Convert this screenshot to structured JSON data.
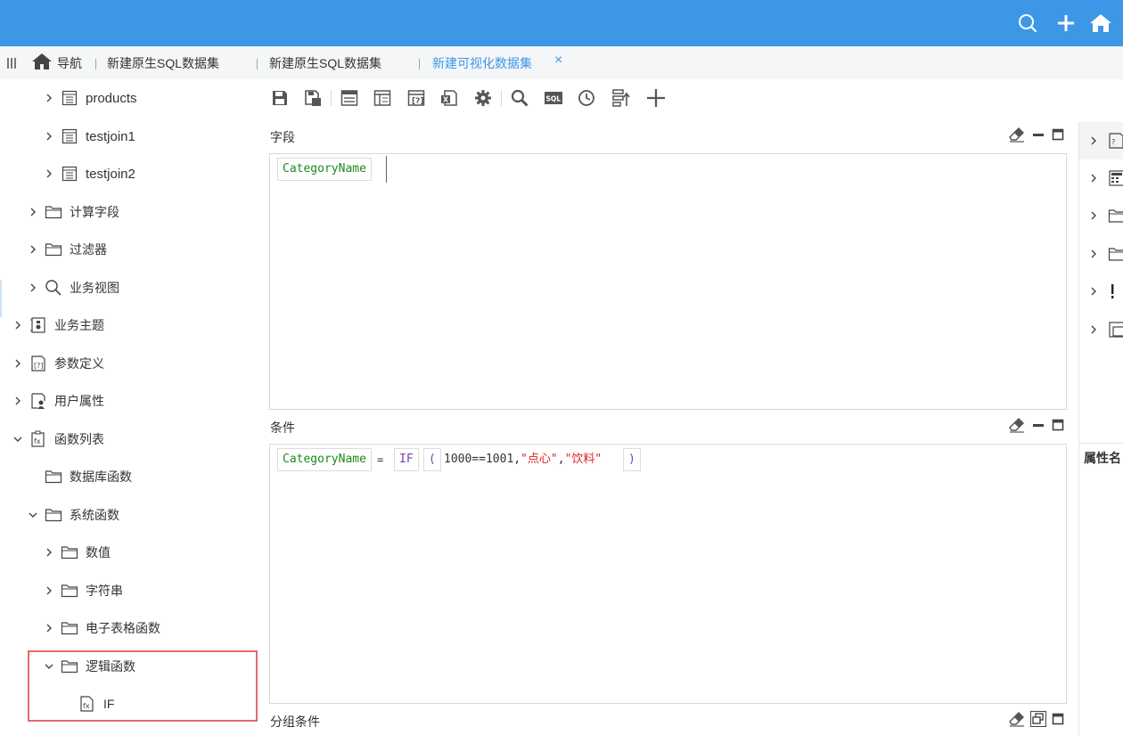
{
  "tabs": {
    "nav_label": "导航",
    "items": [
      {
        "label": "新建原生SQL数据集",
        "active": false
      },
      {
        "label": "新建原生SQL数据集",
        "active": false
      },
      {
        "label": "新建可视化数据集",
        "active": true
      }
    ],
    "close_glyph": "×"
  },
  "sidebar": {
    "items": [
      {
        "label": "products",
        "icon": "table-icon",
        "level": 2,
        "expanded": false
      },
      {
        "label": "testjoin1",
        "icon": "table-icon",
        "level": 2,
        "expanded": false
      },
      {
        "label": "testjoin2",
        "icon": "table-icon",
        "level": 2,
        "expanded": false
      },
      {
        "label": "计算字段",
        "icon": "folder-icon",
        "level": 1,
        "expanded": false
      },
      {
        "label": "过滤器",
        "icon": "folder-icon",
        "level": 1,
        "expanded": false
      },
      {
        "label": "业务视图",
        "icon": "search-icon",
        "level": 1,
        "expanded": false
      },
      {
        "label": "业务主题",
        "icon": "theme-icon",
        "level": 0,
        "expanded": false
      },
      {
        "label": "参数定义",
        "icon": "parameter-icon",
        "level": 0,
        "expanded": false
      },
      {
        "label": "用户属性",
        "icon": "user-attr-icon",
        "level": 0,
        "expanded": false
      },
      {
        "label": "函数列表",
        "icon": "function-list-icon",
        "level": 0,
        "expanded": true
      },
      {
        "label": "数据库函数",
        "icon": "folder-icon",
        "level": 1,
        "expanded": null
      },
      {
        "label": "系统函数",
        "icon": "folder-icon",
        "level": 1,
        "expanded": true
      },
      {
        "label": "数值",
        "icon": "folder-icon",
        "level": 2,
        "expanded": false
      },
      {
        "label": "字符串",
        "icon": "folder-icon",
        "level": 2,
        "expanded": false
      },
      {
        "label": "电子表格函数",
        "icon": "folder-icon",
        "level": 2,
        "expanded": false
      },
      {
        "label": "逻辑函数",
        "icon": "folder-icon",
        "level": 2,
        "expanded": true
      },
      {
        "label": "IF",
        "icon": "function-icon",
        "level": 3,
        "expanded": null
      }
    ]
  },
  "toolbar": {
    "buttons": [
      "save-icon",
      "save-as-icon",
      "table-view-icon",
      "column-view-icon",
      "parameter-icon",
      "excel-icon",
      "settings-icon",
      "search-icon",
      "sql-icon",
      "history-icon",
      "sort-icon",
      "add-icon"
    ],
    "sql_text": "SQL"
  },
  "fields_section": {
    "title": "字段",
    "chip": "CategoryName"
  },
  "condition_section": {
    "title": "条件",
    "field_chip": "CategoryName",
    "operator": "=",
    "func_chip": "IF",
    "open_paren": "(",
    "expr_prefix": "1000==1001,",
    "str1": "\"点心\"",
    "comma": ",",
    "str2": "\"饮料\"",
    "close_paren": ")"
  },
  "group_section": {
    "title": "分组条件"
  },
  "right_panel": {
    "header": "属性名"
  },
  "colors": {
    "topbar": "#3d97e6",
    "active_tab": "#3d97e6",
    "highlight_border": "#e26b6b",
    "field_green": "#1a8a1a",
    "func_purple": "#7b3fb0",
    "string_red": "#dd2222"
  }
}
